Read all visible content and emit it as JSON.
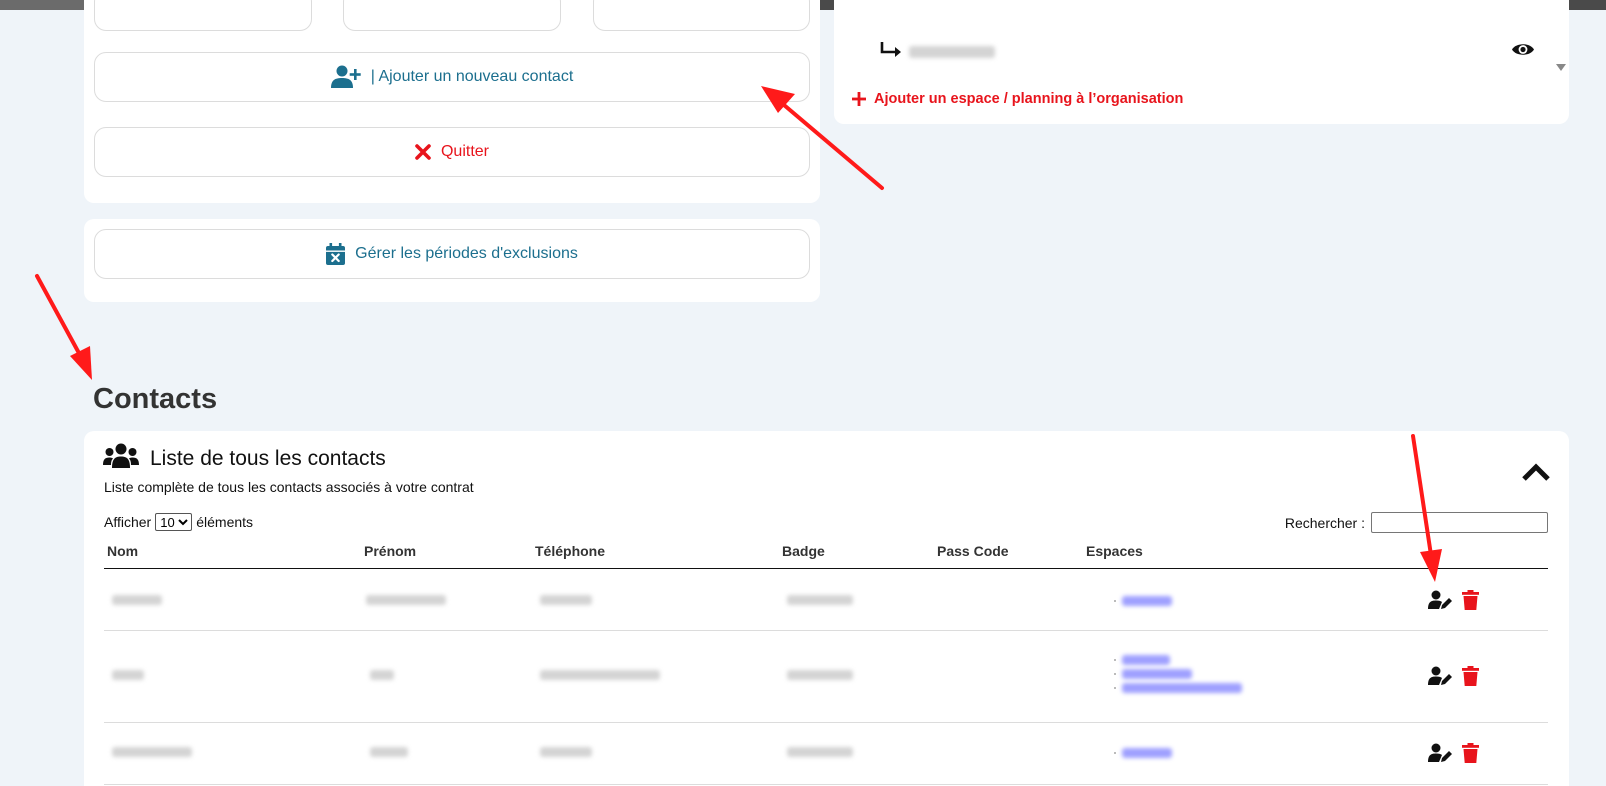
{
  "buttons": {
    "add_contact_label": "| Ajouter un nouveau contact",
    "quit_label": "Quitter",
    "exclusions_label": "Gérer les périodes d'exclusions"
  },
  "right_panel": {
    "add_space_label": "Ajouter un espace / planning à l’organisation"
  },
  "contacts": {
    "heading": "Contacts",
    "card_title": "Liste de tous les contacts",
    "card_subtitle": "Liste complète de tous les contacts associés à votre contrat",
    "show_prefix": "Afficher",
    "show_value": "10",
    "show_suffix": "éléments",
    "search_label": "Rechercher :",
    "columns": [
      "Nom",
      "Prénom",
      "Téléphone",
      "Badge",
      "Pass Code",
      "Espaces"
    ]
  },
  "colors": {
    "teal": "#1c6f8e",
    "red": "#e8141c",
    "background": "#eff4f9"
  },
  "icons": [
    "user-plus-icon",
    "close-x-icon",
    "calendar-x-icon",
    "return-arrow-icon",
    "eye-icon",
    "plus-icon",
    "users-group-icon",
    "chevron-up-icon",
    "user-edit-icon",
    "trash-icon"
  ]
}
